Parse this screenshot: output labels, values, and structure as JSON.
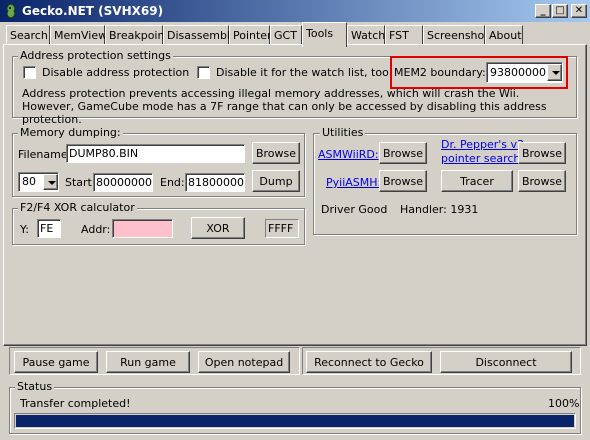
{
  "window": {
    "title": "Gecko.NET (SVHX69)"
  },
  "title_buttons": {
    "minimize": "_",
    "maximize": "□",
    "close": "✕"
  },
  "tabs": [
    {
      "label": "Search"
    },
    {
      "label": "MemView"
    },
    {
      "label": "Breakpoint"
    },
    {
      "label": "Disassembly"
    },
    {
      "label": "Pointer"
    },
    {
      "label": "GCT"
    },
    {
      "label": "Tools"
    },
    {
      "label": "Watch"
    },
    {
      "label": "FST"
    },
    {
      "label": "Screenshot"
    },
    {
      "label": "About"
    }
  ],
  "active_tab": "Tools",
  "address_protection": {
    "title": "Address protection settings",
    "disable_label": "Disable address protection",
    "disable_watch_label": "Disable it for the watch list, too!",
    "mem2_label": "MEM2 boundary:",
    "mem2_value": "93800000",
    "description": "Address protection prevents accessing illegal memory addresses, which will crash the Wii.  However, GameCube mode has a 7F range that can only be accessed by disabling this address protection."
  },
  "memory_dumping": {
    "title": "Memory dumping:",
    "filename_label": "Filename:",
    "filename_value": "DUMP80.BIN",
    "browse_label": "Browse",
    "region_value": "80",
    "start_label": "Start:",
    "start_value": "80000000",
    "end_label": "End:",
    "end_value": "81800000",
    "dump_label": "Dump"
  },
  "xor_calc": {
    "title": "F2/F4 XOR calculator",
    "y_label": "Y:",
    "y_value": "FE",
    "addr_label": "Addr:",
    "addr_value": "",
    "xor_label": "XOR",
    "result": "FFFF"
  },
  "utilities": {
    "title": "Utilities",
    "asmwiird_label": "ASMWiiRD:",
    "browse1": "Browse",
    "drpepper_line1": "Dr. Pepper's v3",
    "drpepper_line2": "pointer search :",
    "browse2": "Browse",
    "pyiiasmh_label": "PyiiASMH:",
    "browse3": "Browse",
    "tracer_label": "Tracer",
    "browse4": "Browse",
    "driver_status": "Driver Good",
    "handler_label": "Handler: 1931"
  },
  "bottom_buttons": {
    "pause": "Pause game",
    "run": "Run game",
    "notepad": "Open notepad",
    "reconnect": "Reconnect to Gecko",
    "disconnect": "Disconnect"
  },
  "status": {
    "title": "Status",
    "text": "Transfer completed!",
    "percent_text": "100%",
    "progress": 1.0
  },
  "colors": {
    "highlight_border": "#e00000",
    "progress_fill": "#0a246a",
    "addr_field_bg": "#ffc0cb",
    "link": "#0000ee"
  }
}
